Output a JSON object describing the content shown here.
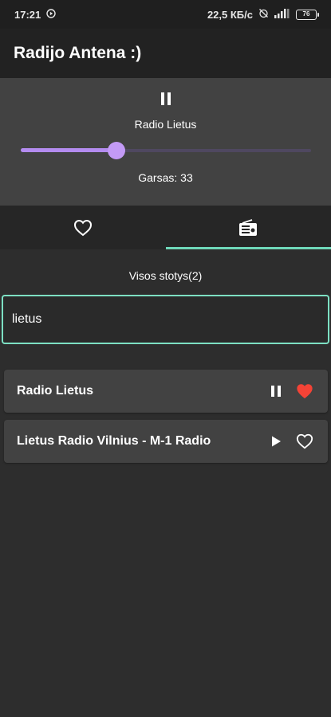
{
  "status_bar": {
    "time": "17:21",
    "network_speed": "22,5 КБ/с",
    "battery": "76"
  },
  "app": {
    "title": "Radijo Antena :)"
  },
  "player": {
    "station_name": "Radio Lietus",
    "volume_label": "Garsas: 33",
    "volume": 33,
    "state": "playing"
  },
  "tabs": [
    {
      "icon": "heart-outline-icon",
      "active": false
    },
    {
      "icon": "radio-icon",
      "active": true
    }
  ],
  "section_title": "Visos stotys(2)",
  "search": {
    "value": "lietus",
    "placeholder": ""
  },
  "stations": [
    {
      "name": "Radio Lietus",
      "state": "playing",
      "favorite": true
    },
    {
      "name": "Lietus Radio Vilnius - M-1 Radio",
      "state": "stopped",
      "favorite": false
    }
  ],
  "colors": {
    "accent": "#6fd8b9",
    "slider": "#b48cf0",
    "favorite": "#f44336",
    "background": "#2d2d2d",
    "card": "#424242"
  }
}
